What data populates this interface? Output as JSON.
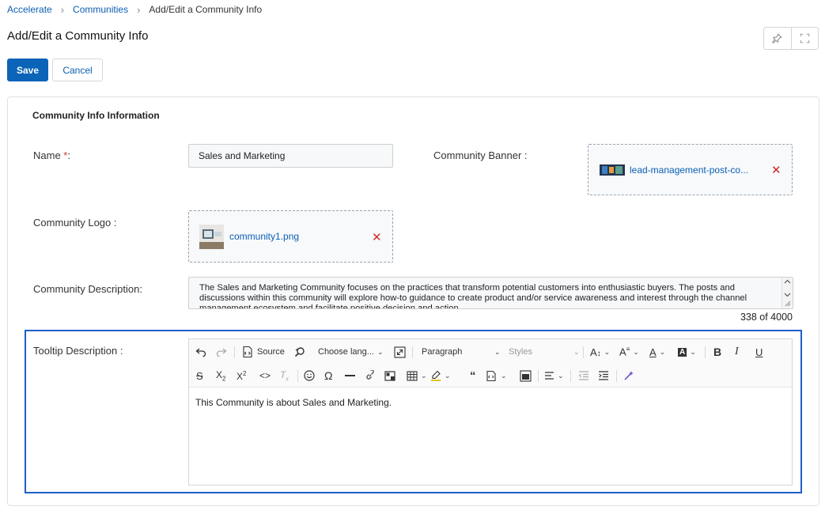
{
  "breadcrumb": {
    "items": [
      "Accelerate",
      "Communities"
    ],
    "current": "Add/Edit a Community Info"
  },
  "page_title": "Add/Edit a Community Info",
  "header_icons": [
    "pin-icon",
    "fullscreen-icon"
  ],
  "actions": {
    "save": "Save",
    "cancel": "Cancel"
  },
  "form": {
    "section_title": "Community Info Information",
    "name": {
      "label": "Name ",
      "required_mark": "*",
      "colon": ":",
      "value": "Sales and Marketing"
    },
    "banner": {
      "label": "Community Banner :",
      "file": "lead-management-post-co..."
    },
    "logo": {
      "label": "Community Logo :",
      "file": "community1.png"
    },
    "description": {
      "label": "Community Description:",
      "value": "The Sales and Marketing Community focuses on the practices that transform potential customers into enthusiastic buyers. The posts and discussions within this community will explore how-to guidance to create product and/or service awareness and interest through the channel management ecosystem and facilitate positive decision and action.",
      "count": "338 of 4000"
    },
    "tooltip": {
      "label": "Tooltip Description :",
      "content": "This Community is about Sales and Marketing."
    }
  },
  "editor_toolbar": {
    "source": "Source",
    "language": "Choose lang...",
    "heading": "Paragraph",
    "styles": "Styles",
    "icons": [
      "undo-icon",
      "redo-icon",
      "source-icon",
      "find-replace-icon",
      "code-block-icon",
      "fullscreen-icon",
      "font-size-icon",
      "font-family-icon",
      "font-color-icon",
      "font-background-icon",
      "bold-icon",
      "italic-icon",
      "underline-icon",
      "strikethrough-icon",
      "subscript-icon",
      "superscript-icon",
      "code-icon",
      "remove-format-icon",
      "emoji-icon",
      "special-characters-icon",
      "horizontal-line-icon",
      "link-icon",
      "image-icon",
      "table-icon",
      "highlight-icon",
      "blockquote-icon",
      "html-embed-icon",
      "media-icon",
      "align-icon",
      "outdent-icon",
      "indent-icon",
      "ai-assistant-icon"
    ]
  },
  "colors": {
    "accent": "#0b64b8",
    "link": "#0b5fb3",
    "danger": "#d4282c",
    "focus_border": "#1f5fc7"
  }
}
